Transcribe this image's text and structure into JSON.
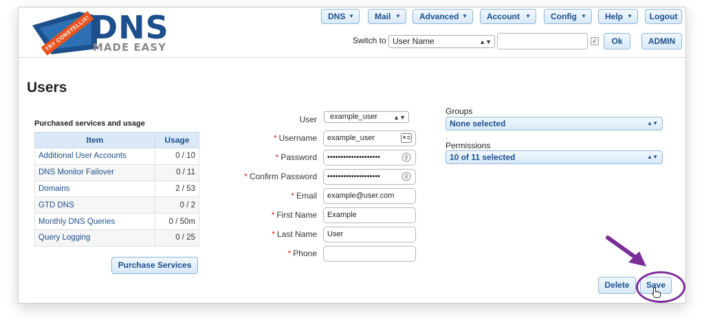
{
  "logo": {
    "name": "DNS",
    "tagline": "MADE EASY",
    "ribbon": "TRY CONSTELLIX!"
  },
  "nav": {
    "dns": "DNS",
    "mail": "Mail",
    "advanced": "Advanced",
    "account": "Account",
    "config": "Config",
    "help": "Help",
    "logout": "Logout"
  },
  "switch_to": {
    "label": "Switch to",
    "selected": "User Name",
    "input_value": "",
    "checked": true,
    "ok_label": "Ok",
    "admin_label": "ADMIN"
  },
  "page": {
    "title": "Users"
  },
  "services": {
    "title": "Purchased services and usage",
    "headers": [
      "Item",
      "Usage"
    ],
    "rows": [
      {
        "item": "Additional User Accounts",
        "usage": "0 / 10"
      },
      {
        "item": "DNS Monitor Failover",
        "usage": "0 / 11"
      },
      {
        "item": "Domains",
        "usage": "2 / 53"
      },
      {
        "item": "GTD DNS",
        "usage": "0 / 2"
      },
      {
        "item": "Monthly DNS Queries",
        "usage": "0 / 50m"
      },
      {
        "item": "Query Logging",
        "usage": "0 / 25"
      }
    ],
    "purchase_label": "Purchase Services"
  },
  "form": {
    "user_label": "User",
    "user_selected": "example_user",
    "username_label": "Username",
    "username_value": "example_user",
    "password_label": "Password",
    "password_value": "••••••••••••••••••••",
    "confirm_label": "Confirm Password",
    "confirm_value": "••••••••••••••••••••",
    "email_label": "Email",
    "email_value": "example@user.com",
    "first_label": "First Name",
    "first_value": "Example",
    "last_label": "Last Name",
    "last_value": "User",
    "phone_label": "Phone",
    "phone_value": "",
    "required_mark": "*"
  },
  "groups": {
    "label": "Groups",
    "value": "None selected"
  },
  "permissions": {
    "label": "Permissions",
    "value": "10 of 11 selected"
  },
  "actions": {
    "delete_label": "Delete",
    "save_label": "Save"
  },
  "colors": {
    "accent": "#1d4f8c",
    "button_bg": "#d7e9f7",
    "required": "#d0261d",
    "highlight": "#7b2d98"
  }
}
